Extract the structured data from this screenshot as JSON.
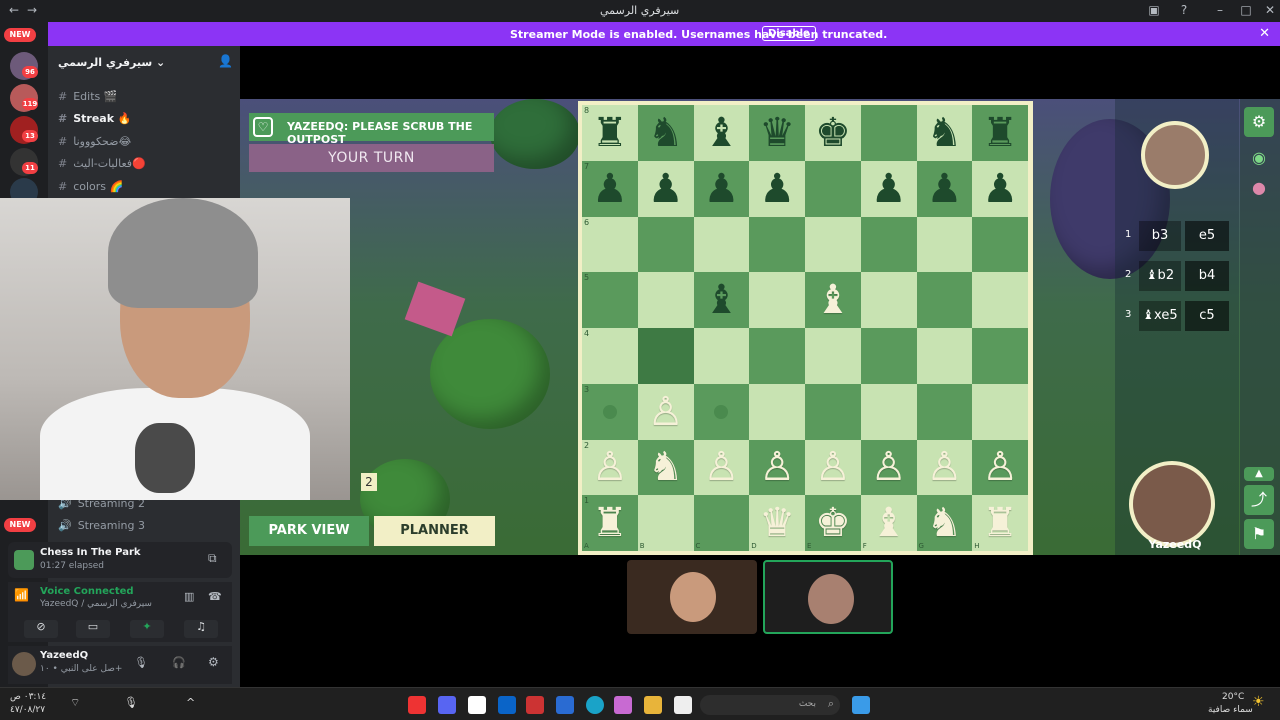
{
  "window": {
    "title": "سيرفري الرسمي"
  },
  "banner": {
    "text": "Streamer Mode is enabled. Usernames have been truncated.",
    "disable_label": "Disable"
  },
  "rail": {
    "badges": [
      "96",
      "119",
      "13",
      "11"
    ],
    "new_label": "NEW"
  },
  "sidebar": {
    "server_name": "سيرفري الرسمي",
    "channels": [
      {
        "label": "Edits 🎬"
      },
      {
        "label": "Streak 🔥"
      },
      {
        "label": "ضحكووونا😂"
      },
      {
        "label": "فعاليات-اليث🔴"
      },
      {
        "label": "colors 🌈"
      }
    ],
    "voice_channels": [
      "Streaming 2",
      "Streaming 3"
    ],
    "new_label": "NEW"
  },
  "activity": {
    "name": "Chess In The Park",
    "elapsed": "01:27 elapsed"
  },
  "voice": {
    "status": "Voice Connected",
    "detail": "YazeedQ / سيرفري الرسمي"
  },
  "user": {
    "name": "YazeedQ",
    "status": "صل على النبي • ١٠+"
  },
  "game": {
    "notice": "YAZEEDQ: PLEASE SCRUB THE OUTPOST",
    "turn": "YOUR TURN",
    "park_view": "PARK VIEW",
    "planner": "PLANNER",
    "counter": "2"
  },
  "board": {
    "ranks": [
      "8",
      "7",
      "6",
      "5",
      "4",
      "3",
      "2",
      "1"
    ],
    "files": [
      "A",
      "B",
      "C",
      "D",
      "E",
      "F",
      "G",
      "H"
    ],
    "rows": [
      [
        "b:♜",
        "b:♞",
        "b:♝",
        "b:♛",
        "b:♚",
        "",
        "b:♞",
        "b:♜"
      ],
      [
        "b:♟",
        "b:♟",
        "b:♟",
        "b:♟",
        "",
        "b:♟",
        "b:♟",
        "b:♟"
      ],
      [
        "",
        "",
        "",
        "",
        "",
        "",
        "",
        ""
      ],
      [
        "",
        "",
        "b:♝",
        "",
        "w:♝",
        "",
        "",
        ""
      ],
      [
        "",
        "hl",
        "",
        "",
        "",
        "",
        "",
        ""
      ],
      [
        "dot",
        "w:♙",
        "dot",
        "",
        "",
        "",
        "",
        ""
      ],
      [
        "w:♙",
        "w:♞",
        "w:♙",
        "w:♙",
        "w:♙",
        "w:♙",
        "w:♙",
        "w:♙"
      ],
      [
        "w:♜",
        "",
        "",
        "w:♛",
        "w:♚",
        "w:♝",
        "w:♞",
        "w:♜"
      ]
    ]
  },
  "moves": [
    {
      "num": "1",
      "white": "b3",
      "black": "e5"
    },
    {
      "num": "2",
      "white": "♝b2",
      "black": "b4"
    },
    {
      "num": "3",
      "white": "♝xe5",
      "black": "c5"
    }
  ],
  "player": {
    "name": "YazeedQ"
  },
  "taskbar": {
    "search_placeholder": "بحث",
    "weather": "20°C",
    "weather_desc": "سماء صافية",
    "time": "٠٣:١٤ ص",
    "date": "٤٧/٠٨/٢٧"
  },
  "colors": {
    "accent_green": "#4c9a59",
    "banner_purple": "#8c34f5",
    "board_light": "#c8e3b2",
    "board_dark": "#5a9a5c"
  }
}
